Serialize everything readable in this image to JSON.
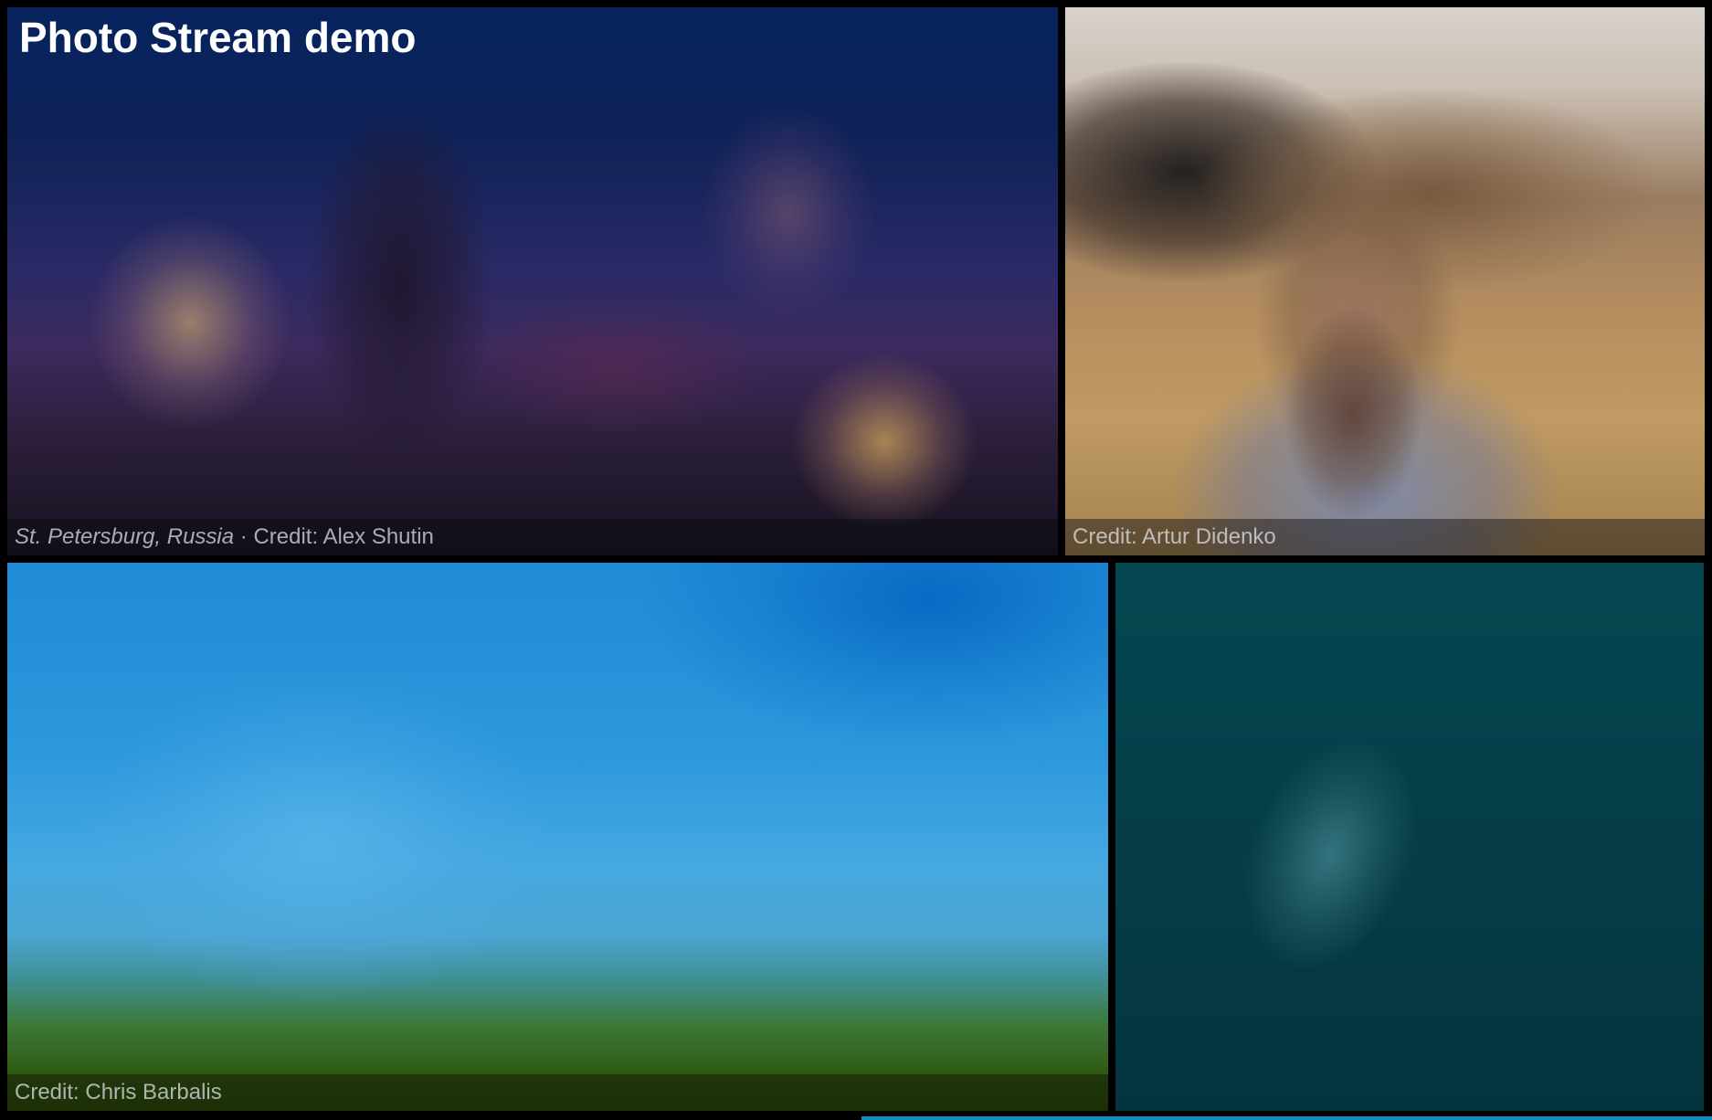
{
  "page": {
    "title": "Photo Stream demo"
  },
  "photos": [
    {
      "location": "St. Petersburg, Russia",
      "separator": " · ",
      "credit": "Credit: Alex Shutin",
      "dominant_color": "#102257"
    },
    {
      "location": "",
      "credit": "Credit: Artur Didenko",
      "dominant_color": "#b48d5f"
    },
    {
      "location": "",
      "credit": "Credit: Chris Barbalis",
      "dominant_color": "#2c98dc"
    },
    {
      "location": "",
      "credit": "",
      "dominant_color": "#053e49"
    }
  ],
  "colors": {
    "background": "#000000",
    "loading_bar": "#1b89c9"
  }
}
